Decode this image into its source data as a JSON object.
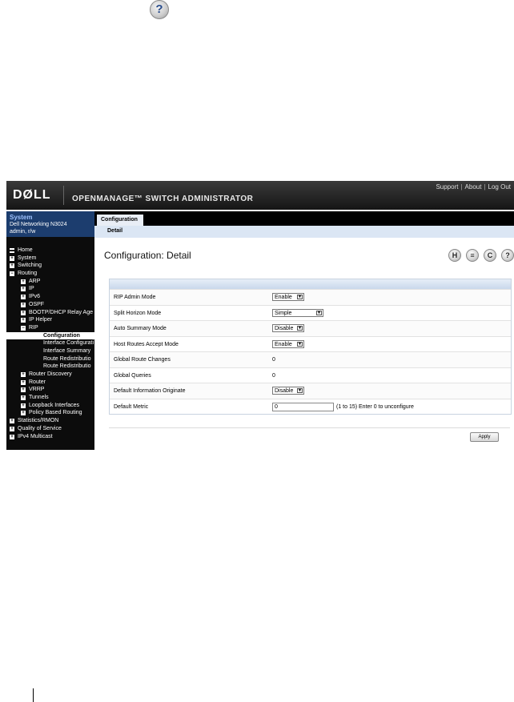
{
  "doc": {
    "help_glyph": "?"
  },
  "header": {
    "logo": "DØLL",
    "app_title": "OPENMANAGE™ SWITCH ADMINISTRATOR",
    "links": [
      "Support",
      "About",
      "Log Out"
    ]
  },
  "system": {
    "title": "System",
    "model": "Dell Networking N3024",
    "user": "admin, r/w"
  },
  "nav": [
    {
      "label": "Home",
      "level": 0,
      "box": "▬"
    },
    {
      "label": "System",
      "level": 0,
      "box": "+"
    },
    {
      "label": "Switching",
      "level": 0,
      "box": "+"
    },
    {
      "label": "Routing",
      "level": 0,
      "box": "−"
    },
    {
      "label": "ARP",
      "level": 1,
      "box": "+"
    },
    {
      "label": "IP",
      "level": 1,
      "box": "+"
    },
    {
      "label": "IPv6",
      "level": 1,
      "box": "+"
    },
    {
      "label": "OSPF",
      "level": 1,
      "box": "+"
    },
    {
      "label": "BOOTP/DHCP Relay Age",
      "level": 1,
      "box": "+"
    },
    {
      "label": "IP Helper",
      "level": 1,
      "box": "+"
    },
    {
      "label": "RIP",
      "level": 1,
      "box": "−"
    },
    {
      "label": "Configuration",
      "level": 2,
      "box": "",
      "selected": true
    },
    {
      "label": "Interface Configurati",
      "level": 2,
      "box": ""
    },
    {
      "label": "Interface Summary",
      "level": 2,
      "box": ""
    },
    {
      "label": "Route Redistributio",
      "level": 2,
      "box": ""
    },
    {
      "label": "Route Redistributio",
      "level": 2,
      "box": ""
    },
    {
      "label": "Router Discovery",
      "level": 1,
      "box": "+"
    },
    {
      "label": "Router",
      "level": 1,
      "box": "+"
    },
    {
      "label": "VRRP",
      "level": 1,
      "box": "+"
    },
    {
      "label": "Tunnels",
      "level": 1,
      "box": "+"
    },
    {
      "label": "Loopback Interfaces",
      "level": 1,
      "box": "+"
    },
    {
      "label": "Policy Based Routing",
      "level": 1,
      "box": "+"
    },
    {
      "label": "Statistics/RMON",
      "level": 0,
      "box": "+"
    },
    {
      "label": "Quality of Service",
      "level": 0,
      "box": "+"
    },
    {
      "label": "IPv4 Multicast",
      "level": 0,
      "box": "+"
    }
  ],
  "tabs": {
    "main": "Configuration",
    "sub": "Detail"
  },
  "page_title": "Configuration: Detail",
  "toolbar_icons": [
    "save-icon",
    "print-icon",
    "refresh-icon",
    "help-icon"
  ],
  "toolbar_glyphs": [
    "H",
    "≡",
    "C",
    "?"
  ],
  "form": {
    "rows": [
      {
        "label": "RIP Admin Mode",
        "type": "select",
        "value": "Enable"
      },
      {
        "label": "Split Horizon Mode",
        "type": "select",
        "value": "Simple"
      },
      {
        "label": "Auto Summary Mode",
        "type": "select",
        "value": "Disable"
      },
      {
        "label": "Host Routes Accept Mode",
        "type": "select",
        "value": "Enable"
      },
      {
        "label": "Global Route Changes",
        "type": "text",
        "value": "0"
      },
      {
        "label": "Global Queries",
        "type": "text",
        "value": "0"
      },
      {
        "label": "Default Information Originate",
        "type": "select",
        "value": "Disable"
      },
      {
        "label": "Default Metric",
        "type": "input",
        "value": "0",
        "hint": "(1 to 15) Enter 0 to unconfigure"
      }
    ]
  },
  "apply_label": "Apply"
}
